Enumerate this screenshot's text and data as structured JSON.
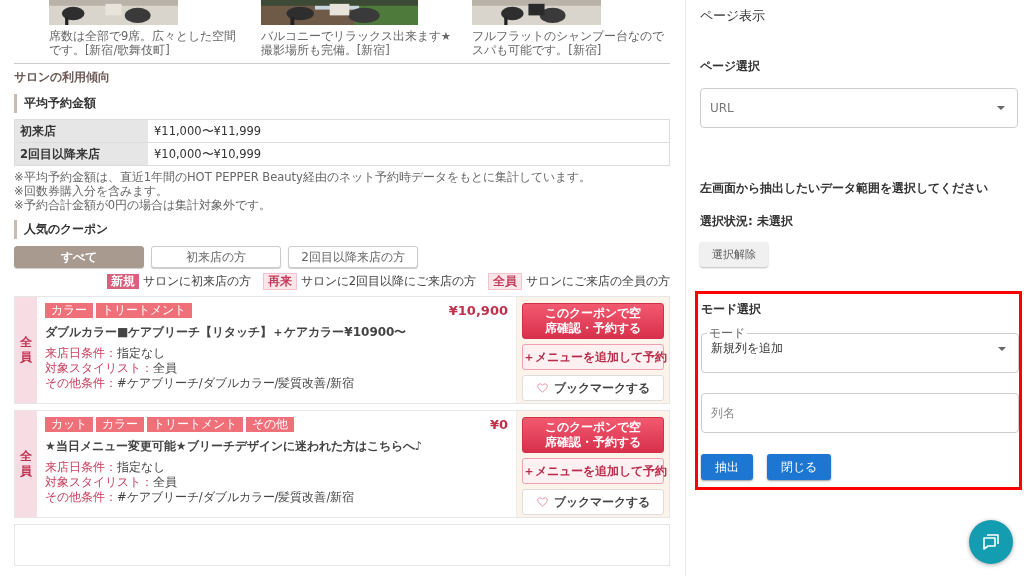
{
  "photos": [
    {
      "kind": "picture",
      "caption": "席数は全部で9席。広々とした空間です。[新宿/歌舞伎町]"
    },
    {
      "kind": "picture",
      "caption": "バルコニーでリラックス出来ます★撮影場所も完備。[新宿]"
    },
    {
      "kind": "picture",
      "caption": "フルフラットのシャンプー台なのでスパも可能です。[新宿]"
    }
  ],
  "section_title": "サロンの利用傾向",
  "avg_price": {
    "heading": "平均予約金額",
    "rows": [
      {
        "label": "初来店",
        "value": "¥11,000〜¥11,999"
      },
      {
        "label": "2回目以降来店",
        "value": "¥10,000〜¥10,999"
      }
    ],
    "notes": [
      "※平均予約金額は、直近1年間のHOT PEPPER Beauty経由のネット予約時データをもとに集計しています。",
      "※回数券購入分を含みます。",
      "※予約合計金額が0円の場合は集計対象外です。"
    ]
  },
  "coupons": {
    "heading": "人気のクーポン",
    "filters": [
      {
        "label": "すべて",
        "selected": true
      },
      {
        "label": "初来店の方",
        "selected": false
      },
      {
        "label": "2回目以降来店の方",
        "selected": false
      }
    ],
    "legend": [
      {
        "kind": "new",
        "badge": "新規",
        "text": "サロンに初来店の方"
      },
      {
        "kind": "repeat",
        "badge": "再来",
        "text": "サロンに2回目以降にご来店の方"
      },
      {
        "kind": "all",
        "badge": "全員",
        "text": "サロンにご来店の全員の方"
      }
    ],
    "items": [
      {
        "target": "全員",
        "tags": [
          "カラー",
          "トリートメント"
        ],
        "price": "¥10,900",
        "title": "ダブルカラー■ケアブリーチ【リタッチ】＋ケアカラー¥10900〜",
        "conditions": [
          {
            "label": "来店日条件：",
            "value": "指定なし"
          },
          {
            "label": "対象スタイリスト：",
            "value": "全員"
          },
          {
            "label": "その他条件：",
            "value": "#ケアブリーチ/ダブルカラー/髪質改善/新宿"
          }
        ],
        "reserve_button": "このクーポンで空席確認・予約する",
        "add_menu_button": "＋メニューを追加して予約",
        "bookmark_button": "ブックマークする"
      },
      {
        "target": "全員",
        "tags": [
          "カット",
          "カラー",
          "トリートメント",
          "その他"
        ],
        "price": "¥0",
        "title": "★当日メニュー変更可能★ブリーチデザインに迷われた方はこちらへ♪",
        "conditions": [
          {
            "label": "来店日条件：",
            "value": "指定なし"
          },
          {
            "label": "対象スタイリスト：",
            "value": "全員"
          },
          {
            "label": "その他条件：",
            "value": "#ケアブリーチ/ダブルカラー/髪質改善/新宿"
          }
        ],
        "reserve_button": "このクーポンで空席確認・予約する",
        "add_menu_button": "＋メニューを追加して予約",
        "bookmark_button": "ブックマークする"
      }
    ]
  },
  "panel": {
    "title": "ページ表示",
    "page_select_label": "ページ選択",
    "url_select": {
      "placeholder": "URL"
    },
    "instruction": "左画面から抽出したいデータ範囲を選択してください",
    "status": "選択状況: 未選択",
    "clear_button": "選択解除",
    "mode": {
      "heading": "モード選択",
      "select_label": "モード",
      "select_value": "新規列を追加",
      "column_field": {
        "placeholder": "列名"
      },
      "buttons": [
        "抽出",
        "閉じる"
      ]
    }
  }
}
